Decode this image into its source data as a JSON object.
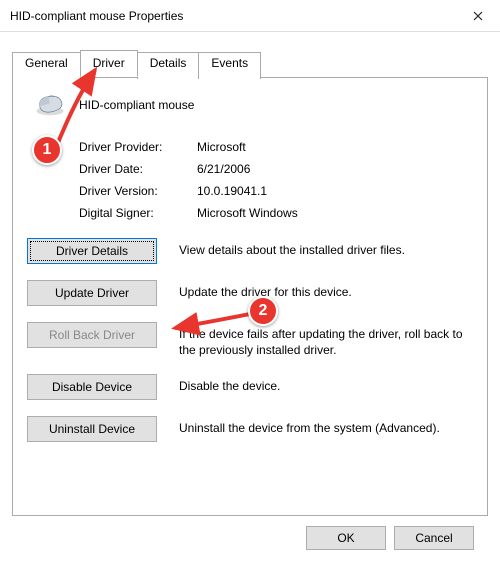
{
  "title": "HID-compliant mouse Properties",
  "tabs": {
    "general": "General",
    "driver": "Driver",
    "details": "Details",
    "events": "Events"
  },
  "device_name": "HID-compliant mouse",
  "info": {
    "provider_label": "Driver Provider:",
    "provider_value": "Microsoft",
    "date_label": "Driver Date:",
    "date_value": "6/21/2006",
    "version_label": "Driver Version:",
    "version_value": "10.0.19041.1",
    "signer_label": "Digital Signer:",
    "signer_value": "Microsoft Windows"
  },
  "buttons": {
    "details": "Driver Details",
    "details_desc": "View details about the installed driver files.",
    "update": "Update Driver",
    "update_desc": "Update the driver for this device.",
    "rollback": "Roll Back Driver",
    "rollback_desc": "If the device fails after updating the driver, roll back to the previously installed driver.",
    "disable": "Disable Device",
    "disable_desc": "Disable the device.",
    "uninstall": "Uninstall Device",
    "uninstall_desc": "Uninstall the device from the system (Advanced)."
  },
  "footer": {
    "ok": "OK",
    "cancel": "Cancel"
  },
  "annotations": {
    "badge1": "1",
    "badge2": "2"
  }
}
